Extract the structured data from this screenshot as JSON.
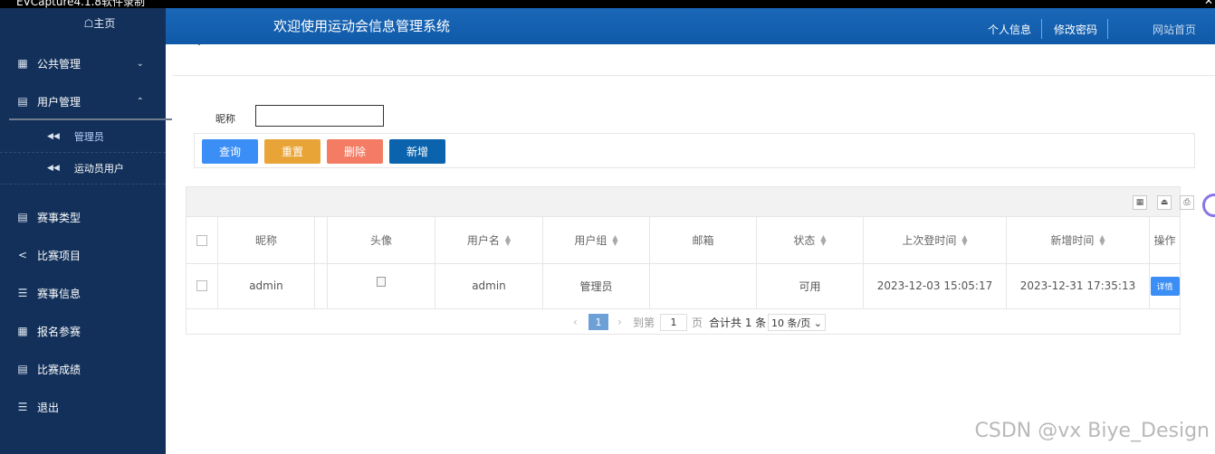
{
  "recorder": {
    "title": "EVCapture4.1.8软件录制"
  },
  "sidebar": {
    "home": "☖主页",
    "menu": [
      {
        "label": "公共管理",
        "icon": "grid-icon",
        "arrow": "chevron-down-icon"
      },
      {
        "label": "用户管理",
        "icon": "book-icon",
        "arrow": "chevron-up-icon"
      }
    ],
    "submenu": [
      {
        "label": "管理员",
        "icon": "double-left-icon"
      },
      {
        "label": "运动员用户",
        "icon": "double-left-icon"
      }
    ],
    "menu2": [
      {
        "label": "赛事类型",
        "icon": "book-icon"
      },
      {
        "label": "比赛项目",
        "icon": "share-icon"
      },
      {
        "label": "赛事信息",
        "icon": "list-icon"
      },
      {
        "label": "报名参赛",
        "icon": "grid-icon"
      },
      {
        "label": "比赛成绩",
        "icon": "book-icon"
      },
      {
        "label": "退出",
        "icon": "list-icon"
      }
    ]
  },
  "header": {
    "title": "欢迎使用运动会信息管理系统",
    "profile": "个人信息",
    "password": "修改密码",
    "site": "网站首页"
  },
  "search": {
    "label": "昵称",
    "value": ""
  },
  "buttons": {
    "query": "查询",
    "reset": "重置",
    "delete": "删除",
    "add": "新增"
  },
  "table": {
    "columns": [
      "昵称",
      "头像",
      "用户名",
      "用户组",
      "邮箱",
      "状态",
      "上次登时间",
      "新增时间",
      "操作"
    ],
    "rows": [
      {
        "nickname": "admin",
        "username": "admin",
        "group": "管理员",
        "email": "",
        "status": "可用",
        "last_login": "2023-12-03 15:05:17",
        "created": "2023-12-31 17:35:13",
        "action": "详情"
      }
    ]
  },
  "pager": {
    "prev": "‹",
    "current": "1",
    "next": "›",
    "goto": "到第",
    "input": "1",
    "page": "页",
    "total": "合计共 1 条",
    "size": "10 条/页 ⌄"
  },
  "watermark": "CSDN @vx Biye_Design"
}
